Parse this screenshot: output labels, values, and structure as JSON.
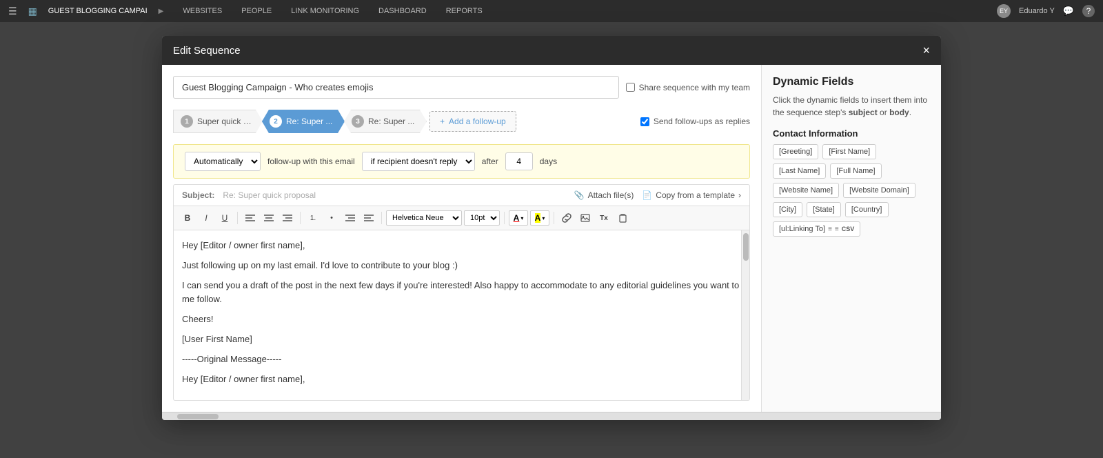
{
  "topnav": {
    "menu_icon": "☰",
    "brand_icon": "▦",
    "campaign_name": "GUEST BLOGGING CAMPAI",
    "arrow": "▶",
    "nav_items": [
      "WEBSITES",
      "PEOPLE",
      "LINK MONITORING",
      "DASHBOARD",
      "REPORTS"
    ],
    "user_name": "Eduardo Y",
    "notif_icon": "💬",
    "help_icon": "?"
  },
  "modal": {
    "title": "Edit Sequence",
    "close_btn": "×",
    "seq_name": "Guest Blogging Campaign - Who creates emojis",
    "share_label": "Share sequence with my team",
    "steps": [
      {
        "num": "1",
        "text": "Super quick p...",
        "active": false
      },
      {
        "num": "2",
        "text": "Re: Super ...",
        "active": true
      },
      {
        "num": "3",
        "text": "Re: Super ...",
        "active": false
      }
    ],
    "add_followup_label": "Add a follow-up",
    "send_followup_label": "Send follow-ups as replies",
    "config": {
      "auto_label": "Automatically",
      "followup_label": "follow-up with this email",
      "condition_label": "if recipient doesn't reply",
      "after_label": "after",
      "days_value": "4",
      "days_label": "days"
    },
    "subject_label": "Subject:",
    "subject_value": "Re: Super quick proposal",
    "attach_label": "Attach file(s)",
    "copy_template_label": "Copy from a template",
    "toolbar": {
      "bold": "B",
      "italic": "I",
      "underline": "U",
      "align_left": "≡",
      "align_center": "≡",
      "align_right": "≡",
      "ol": "1.",
      "ul": "•",
      "indent": "→",
      "outdent": "←",
      "font": "Helvetica Neue",
      "font_size": "10pt",
      "font_color": "A",
      "highlight_color": "A",
      "link": "🔗",
      "image": "🖼",
      "format": "Tx",
      "paste": "📋"
    },
    "editor": {
      "line1": "Hey [Editor / owner first name],",
      "line2": "",
      "line3": "Just following up on my last email. I'd love to contribute to your blog :)",
      "line4": "",
      "line5": "I can send you a draft of the post in the next few days if you're interested! Also happy to accommodate to any editorial guidelines you want to me follow.",
      "line6": "",
      "line7": "Cheers!",
      "line8": "[User First Name]",
      "line9": "",
      "line10": "-----Original Message-----",
      "line11": "Hey [Editor / owner first name],"
    }
  },
  "right_panel": {
    "title": "Dynamic Fields",
    "description_part1": "Click the dynamic fields to insert them into the sequence step's ",
    "description_bold1": "subject",
    "description_part2": " or ",
    "description_bold2": "body",
    "description_part3": ".",
    "contact_section_title": "Contact Information",
    "contact_fields": [
      "[Greeting]",
      "[First Name]",
      "[Last Name]",
      "[Full Name]",
      "[Website Name]",
      "[Website Domain]",
      "[City]",
      "[State]",
      "[Country]"
    ],
    "special_field": "[ul:Linking To]",
    "special_field_icons": [
      "≡",
      "≡",
      "CSV"
    ]
  }
}
